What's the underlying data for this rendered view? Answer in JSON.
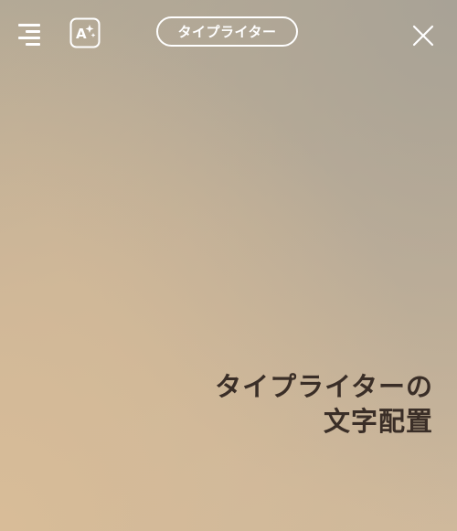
{
  "toolbar": {
    "menu_icon": "align-right-lines-icon",
    "ai_text_icon": "text-sparkle-icon",
    "ai_text_letter": "A",
    "font_name": "タイプライター",
    "close_icon": "close-icon"
  },
  "canvas": {
    "caption_line1": "タイプライターの",
    "caption_line2": "文字配置",
    "caption_color": "#3a2e27"
  },
  "colors": {
    "icon": "#ffffff",
    "background_top": "#b3a996",
    "background_bottom": "#d8bc98"
  }
}
